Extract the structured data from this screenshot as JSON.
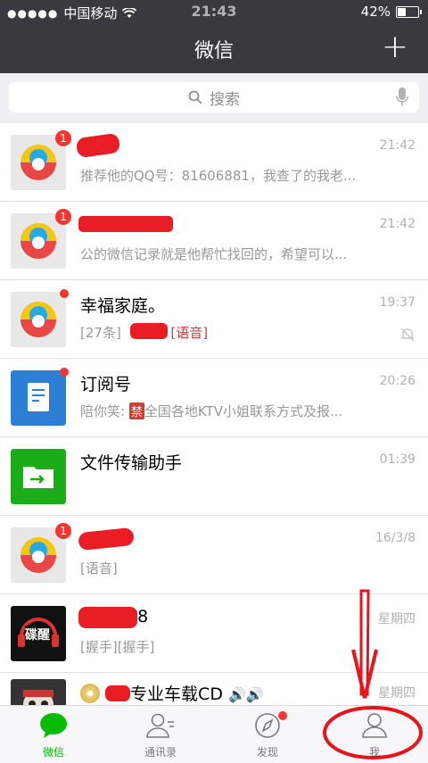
{
  "status": {
    "carrier": "中国移动",
    "time": "21:43",
    "battery_text": "42%",
    "battery_level": 0.42
  },
  "nav": {
    "title": "微信",
    "add_icon": "plus-icon"
  },
  "search": {
    "placeholder": "搜索"
  },
  "chats": [
    {
      "name": "",
      "time": "21:42",
      "preview": "推荐他的QQ号：81606881，我查了的我老...",
      "badge": "1",
      "avatar": "qq-news-avatar"
    },
    {
      "name": "",
      "time": "21:42",
      "preview": "公的微信记录就是他帮忙找回的，希望可以...",
      "badge": "1",
      "avatar": "qq-news-avatar"
    },
    {
      "name": "幸福家庭。",
      "time": "19:37",
      "preview_prefix": "[27条]",
      "preview": "[语音]",
      "avatar": "qq-news-avatar",
      "muted": true
    },
    {
      "name": "订阅号",
      "time": "20:26",
      "preview_prefix": "陪你笑:",
      "forbid_label": "禁",
      "preview": "全国各地KTV小姐联系方式及报...",
      "avatar": "subscription-avatar"
    },
    {
      "name": "文件传输助手",
      "time": "01:39",
      "preview": "",
      "avatar": "file-transfer-avatar"
    },
    {
      "name": "",
      "time": "16/3/8",
      "preview": "[语音]",
      "badge": "1",
      "avatar": "qq-news-avatar"
    },
    {
      "name": "888",
      "time": "星期四",
      "preview": "[握手][握手]",
      "avatar": "headphone-avatar",
      "avatar_text": "碟醒"
    },
    {
      "name": "专业车载CD",
      "time": "星期四",
      "preview": "",
      "avatar": "skull-avatar"
    }
  ],
  "tabs": [
    {
      "label": "微信",
      "icon": "chat-bubble-icon",
      "active": true
    },
    {
      "label": "通讯录",
      "icon": "contacts-icon"
    },
    {
      "label": "发现",
      "icon": "compass-icon"
    },
    {
      "label": "我",
      "icon": "person-icon"
    }
  ],
  "colors": {
    "nav_bg": "#393a3f",
    "accent_green": "#09bb07",
    "badge_red": "#f43530",
    "annotation_red": "#e8141c"
  }
}
